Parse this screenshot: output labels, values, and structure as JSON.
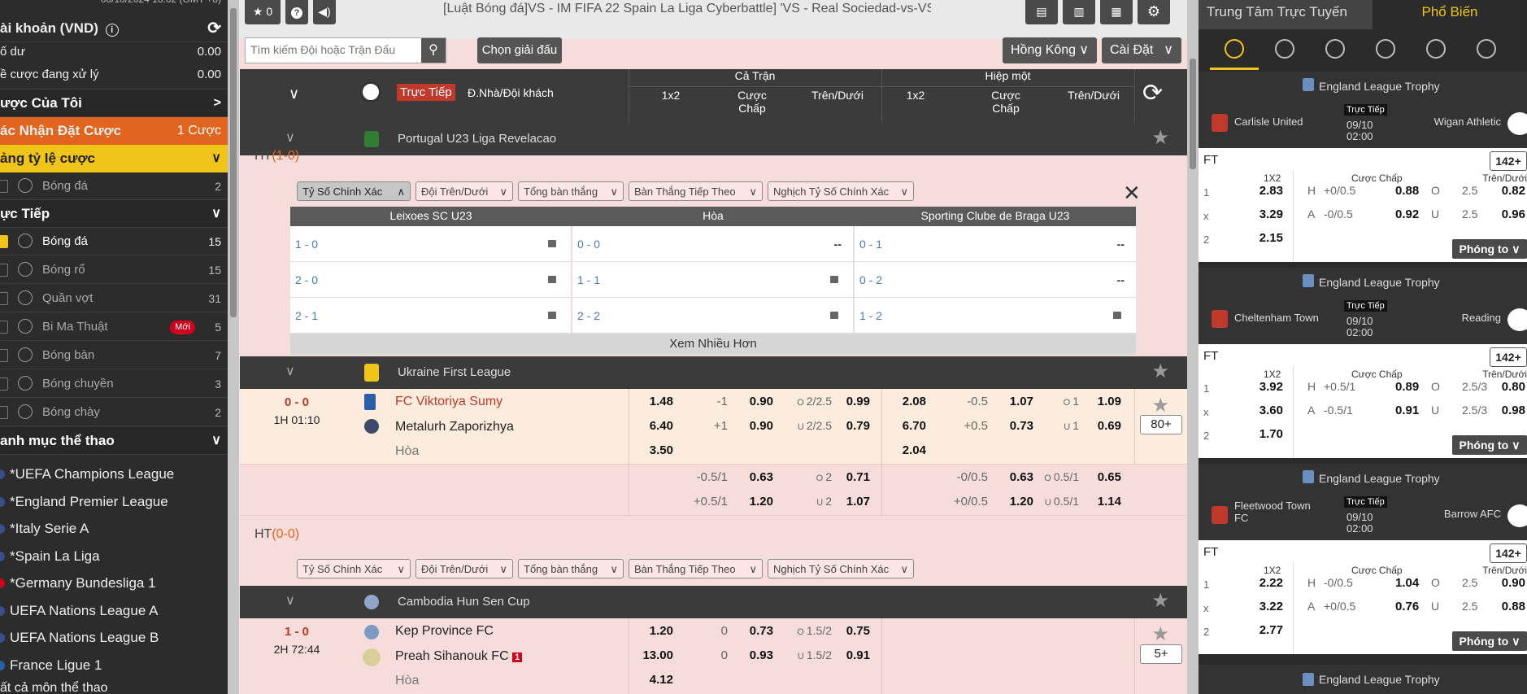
{
  "left": {
    "datetime": "08/10/2024 18:02 (GMT +8)",
    "account_title": "ài khoản (VND)",
    "balance_label": "ố dư",
    "balance_value": "0.00",
    "pending_label": "ề cược đang xử lý",
    "pending_value": "0.00",
    "my_bets": "ược Của Tôi",
    "confirm_label": "ác Nhận Đặt Cược",
    "confirm_count": "1 Cược",
    "odds_table": "ảng tỷ lệ cược",
    "odds_sport": "Bóng đá",
    "odds_count": "2",
    "live_section": "ực Tiếp",
    "live_sports": [
      {
        "name": "Bóng đá",
        "count": "15",
        "checked": true,
        "icon": "soccer-ball-icon"
      },
      {
        "name": "Bóng rổ",
        "count": "15",
        "checked": false,
        "icon": "basketball-icon"
      },
      {
        "name": "Quần vợt",
        "count": "31",
        "checked": false,
        "icon": "tennis-icon"
      },
      {
        "name": "Bi Ma Thuật",
        "count": "5",
        "checked": false,
        "icon": "magic-ball-icon",
        "badge": "Mới"
      },
      {
        "name": "Bóng bàn",
        "count": "7",
        "checked": false,
        "icon": "table-tennis-icon"
      },
      {
        "name": "Bóng chuyền",
        "count": "3",
        "checked": false,
        "icon": "volleyball-icon"
      },
      {
        "name": "Bóng chày",
        "count": "2",
        "checked": false,
        "icon": "baseball-icon"
      }
    ],
    "categories_title": "anh mục thể thao",
    "leagues": [
      "*UEFA Champions League",
      "*England Premier League",
      "*Italy Serie A",
      "*Spain La Liga",
      "*Germany Bundesliga 1",
      "UEFA Nations League A",
      "UEFA Nations League B",
      "France Ligue 1"
    ],
    "all_sports": "ất cả môn thể thao"
  },
  "top": {
    "star_count": "0",
    "breadcrumb": "[Luật Bóng đá]VS - IM FIFA 22 Spain La Liga Cyberbattle] 'VS - Real Sociedad-vs-VS - Levante' -",
    "search_placeholder": "Tìm kiếm Đội hoặc Trận Đấu",
    "choose_league": "Chọn giải đấu",
    "region": "Hồng Kông",
    "settings": "Cài Đặt"
  },
  "header": {
    "live": "Trực Tiếp",
    "home_away": "Đ.Nhà/Đội khách",
    "full_match": "Cả Trận",
    "first_half": "Hiệp một",
    "col_1x2": "1x2",
    "col_handicap": "Cược Chấp",
    "col_ou": "Trên/Dưới"
  },
  "league1": {
    "name": "Portugal U23 Liga Revelacao",
    "ht_label": "HT",
    "ht_score": "(1-0)",
    "filters": [
      "Tỷ Số Chính Xác",
      "Đội Trên/Dưới",
      "Tổng bàn thắng",
      "Bàn Thắng Tiếp Theo",
      "Nghịch Tỷ Số Chính Xác"
    ],
    "cs_headers": [
      "Leixoes SC U23",
      "Hòa",
      "Sporting Clube de Braga U23"
    ],
    "cs_rows": [
      [
        {
          "score": "1 - 0",
          "val": "",
          "locked": true
        },
        {
          "score": "0 - 0",
          "val": "--",
          "locked": false
        },
        {
          "score": "0 - 1",
          "val": "--",
          "locked": false
        }
      ],
      [
        {
          "score": "2 - 0",
          "val": "",
          "locked": true
        },
        {
          "score": "1 - 1",
          "val": "",
          "locked": true
        },
        {
          "score": "0 - 2",
          "val": "--",
          "locked": false
        }
      ],
      [
        {
          "score": "2 - 1",
          "val": "",
          "locked": true
        },
        {
          "score": "2 - 2",
          "val": "",
          "locked": true
        },
        {
          "score": "1 - 2",
          "val": "",
          "locked": true
        }
      ]
    ],
    "more": "Xem Nhiều Hơn"
  },
  "league2": {
    "name": "Ukraine First League",
    "score_home": "0",
    "score_sep": "-",
    "score_away": "0",
    "time": "1H 01:10",
    "home": "FC Viktoriya Sumy",
    "away": "Metalurh Zaporizhya",
    "draw": "Hòa",
    "more_bets": "80+",
    "ft_1x2": [
      "1.48",
      "6.40",
      "3.50"
    ],
    "ft_hcp": [
      {
        "line": "-1",
        "odd": "0.90"
      },
      {
        "line": "+1",
        "odd": "0.90"
      }
    ],
    "ft_ou": [
      {
        "side": "O",
        "line": "2/2.5",
        "odd": "0.99"
      },
      {
        "side": "U",
        "line": "2/2.5",
        "odd": "0.79"
      }
    ],
    "h1_1x2": [
      "2.08",
      "6.70",
      "2.04"
    ],
    "h1_hcp": [
      {
        "line": "-0.5",
        "odd": "1.07"
      },
      {
        "line": "+0.5",
        "odd": "0.73"
      }
    ],
    "h1_ou": [
      {
        "side": "O",
        "line": "1",
        "odd": "1.09"
      },
      {
        "side": "U",
        "line": "1",
        "odd": "0.69"
      }
    ],
    "alt_ft_hcp": [
      {
        "line": "-0.5/1",
        "odd": "0.63"
      },
      {
        "line": "+0.5/1",
        "odd": "1.20"
      }
    ],
    "alt_ft_ou": [
      {
        "side": "O",
        "line": "2",
        "odd": "0.71"
      },
      {
        "side": "U",
        "line": "2",
        "odd": "1.07"
      }
    ],
    "alt_h1_hcp": [
      {
        "line": "-0/0.5",
        "odd": "0.63"
      },
      {
        "line": "+0/0.5",
        "odd": "1.20"
      }
    ],
    "alt_h1_ou": [
      {
        "side": "O",
        "line": "0.5/1",
        "odd": "0.65"
      },
      {
        "side": "U",
        "line": "0.5/1",
        "odd": "1.14"
      }
    ],
    "ht_label": "HT",
    "ht_score": "(0-0)",
    "filters": [
      "Tỷ Số Chính Xác",
      "Đội Trên/Dưới",
      "Tổng bàn thắng",
      "Bàn Thắng Tiếp Theo",
      "Nghịch Tỷ Số Chính Xác"
    ]
  },
  "league3": {
    "name": "Cambodia Hun Sen Cup",
    "score_home": "1",
    "score_sep": "-",
    "score_away": "0",
    "time": "2H 72:44",
    "home": "Kep Province FC",
    "away": "Preah Sihanouk FC",
    "red_card": "1",
    "draw": "Hòa",
    "more_bets": "5+",
    "ft_1x2": [
      "1.20",
      "13.00",
      "4.12"
    ],
    "ft_hcp": [
      {
        "line": "0",
        "odd": "0.73"
      },
      {
        "line": "0",
        "odd": "0.93"
      }
    ],
    "ft_ou": [
      {
        "side": "O",
        "line": "1.5/2",
        "odd": "0.75"
      },
      {
        "side": "U",
        "line": "1.5/2",
        "odd": "0.91"
      }
    ]
  },
  "right": {
    "tab_online": "Trung Tâm Trực Tuyến",
    "tab_popular": "Phổ Biến",
    "sport_icons": [
      "soccer-ball-icon",
      "basketball-icon",
      "tennis-icon",
      "table-tennis-icon",
      "volleyball-icon",
      "baseball-icon"
    ],
    "matches": [
      {
        "league": "England League Trophy",
        "home": "Carlisle United",
        "away": "Wigan Athletic",
        "live": "Trực Tiếp",
        "date": "09/10",
        "time": "02:00",
        "ft": "FT",
        "more": "142+",
        "h_1x2": "1X2",
        "h_hcp": "Cược Chấp",
        "h_ou": "Trên/Dưới",
        "rows": [
          {
            "k": "1",
            "v": "2.83",
            "hs": "H",
            "hl": "+0/0.5",
            "hv": "0.88",
            "os": "O",
            "ol": "2.5",
            "ov": "0.82"
          },
          {
            "k": "x",
            "v": "3.29",
            "hs": "A",
            "hl": "-0/0.5",
            "hv": "0.92",
            "os": "U",
            "ol": "2.5",
            "ov": "0.96"
          },
          {
            "k": "2",
            "v": "2.15"
          }
        ],
        "phong": "Phóng to"
      },
      {
        "league": "England League Trophy",
        "home": "Cheltenham Town",
        "away": "Reading",
        "live": "Trực Tiếp",
        "date": "09/10",
        "time": "02:00",
        "ft": "FT",
        "more": "142+",
        "h_1x2": "1X2",
        "h_hcp": "Cược Chấp",
        "h_ou": "Trên/Dưới",
        "rows": [
          {
            "k": "1",
            "v": "3.92",
            "hs": "H",
            "hl": "+0.5/1",
            "hv": "0.89",
            "os": "O",
            "ol": "2.5/3",
            "ov": "0.80"
          },
          {
            "k": "x",
            "v": "3.60",
            "hs": "A",
            "hl": "-0.5/1",
            "hv": "0.91",
            "os": "U",
            "ol": "2.5/3",
            "ov": "0.98"
          },
          {
            "k": "2",
            "v": "1.70"
          }
        ],
        "phong": "Phóng to"
      },
      {
        "league": "England League Trophy",
        "home": "Fleetwood Town FC",
        "away": "Barrow AFC",
        "live": "Trực Tiếp",
        "date": "09/10",
        "time": "02:00",
        "ft": "FT",
        "more": "142+",
        "h_1x2": "1X2",
        "h_hcp": "Cược Chấp",
        "h_ou": "Trên/Dưới",
        "rows": [
          {
            "k": "1",
            "v": "2.22",
            "hs": "H",
            "hl": "-0/0.5",
            "hv": "1.04",
            "os": "O",
            "ol": "2.5",
            "ov": "0.90"
          },
          {
            "k": "x",
            "v": "3.22",
            "hs": "A",
            "hl": "+0/0.5",
            "hv": "0.76",
            "os": "U",
            "ol": "2.5",
            "ov": "0.88"
          },
          {
            "k": "2",
            "v": "2.77"
          }
        ],
        "phong": "Phóng to"
      }
    ],
    "next_league": "England League Trophy"
  },
  "colors": {
    "orange": "#e1651f",
    "yellow": "#f0c419",
    "red_text": "#c0392b",
    "accent": "#f0c419"
  }
}
